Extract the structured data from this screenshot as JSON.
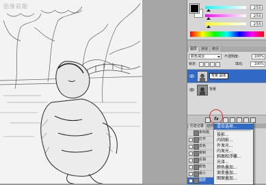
{
  "canvas": {
    "watermark": "图像前期"
  },
  "color_panel": {
    "sliders": [
      {
        "channel": "R",
        "value": "255",
        "gradient": "#00ffff"
      },
      {
        "channel": "G",
        "value": "255",
        "gradient": "#ff00ff"
      },
      {
        "channel": "B",
        "value": "255",
        "gradient": "#ffff00"
      }
    ]
  },
  "layers_panel": {
    "tabs": [
      "图层",
      "通道",
      "路径"
    ],
    "blend_mode": "颜色减淡",
    "opacity_label": "不透明度:",
    "opacity_value": "100%",
    "lock_label": "锁定:",
    "fill_label": "填充:",
    "fill_value": "100%",
    "layers": [
      {
        "name": "背景 副本",
        "selected": true
      },
      {
        "name": "背景",
        "selected": false
      }
    ],
    "fx_label": "fx"
  },
  "history_panel": {
    "tabs": [
      "历史记录",
      "动作"
    ],
    "items": [
      "未标题",
      "打开",
      "去色",
      "复制",
      "反相",
      "颜色",
      "最小",
      "图层"
    ]
  },
  "fx_menu": {
    "items": [
      "混合选项...",
      "投影...",
      "内阴影...",
      "外发光...",
      "内发光...",
      "斜面和浮雕...",
      "光泽...",
      "颜色叠加...",
      "渐变叠加...",
      "图案叠加..."
    ]
  }
}
